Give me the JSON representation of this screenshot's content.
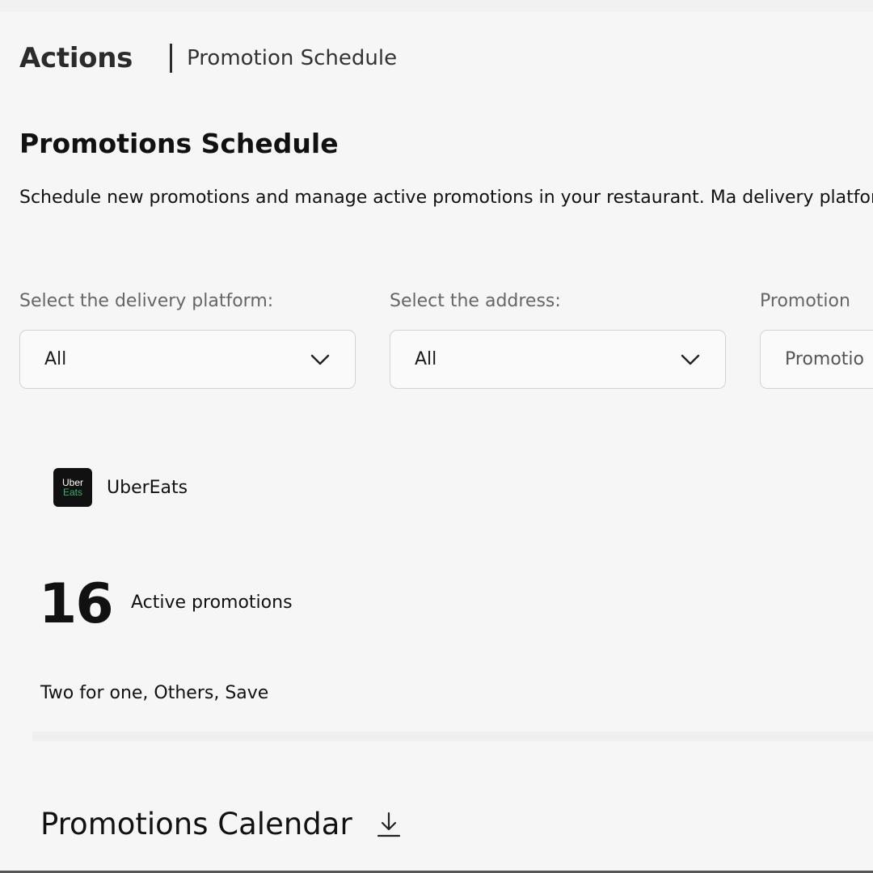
{
  "header": {
    "section": "Actions",
    "current_page": "Promotion Schedule"
  },
  "main": {
    "title": "Promotions Schedule",
    "description": "Schedule new promotions and manage active promotions in your restaurant. Ma delivery platforms."
  },
  "filters": [
    {
      "label": "Select the delivery platform:",
      "value": "All"
    },
    {
      "label": "Select the address:",
      "value": "All"
    },
    {
      "label": "Promotion",
      "value": "Promotio"
    }
  ],
  "platform": {
    "logo_top": "Uber",
    "logo_bottom": "Eats",
    "name": "UberEats",
    "logo_colors": {
      "background": "#111111",
      "accent": "#2fb36a"
    }
  },
  "stats": {
    "active_count": "16",
    "active_label": "Active promotions",
    "promotion_types": "Two for one, Others, Save"
  },
  "calendar": {
    "title": "Promotions Calendar",
    "download_icon": "download-icon"
  }
}
